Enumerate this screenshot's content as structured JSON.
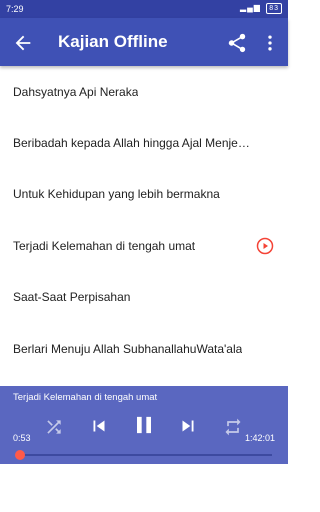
{
  "status_bar": {
    "time": "7:29",
    "battery": "83"
  },
  "app_bar": {
    "title": "Kajian Offline"
  },
  "list": [
    {
      "label": "Dahsyatnya Api Neraka",
      "playing": false
    },
    {
      "label": "Beribadah kepada Allah hingga Ajal Menjemput",
      "playing": false
    },
    {
      "label": "Untuk Kehidupan yang lebih bermakna",
      "playing": false
    },
    {
      "label": "Terjadi Kelemahan di tengah umat",
      "playing": true
    },
    {
      "label": "Saat-Saat Perpisahan",
      "playing": false
    },
    {
      "label": "Berlari Menuju Allah SubhanallahuWata'ala",
      "playing": false
    }
  ],
  "player": {
    "now_playing": "Terjadi Kelemahan di tengah umat",
    "elapsed": "0:53",
    "total": "1:42:01",
    "progress": 0.0087
  },
  "colors": {
    "status_bar": "#3341a3",
    "app_bar": "#3f51b5",
    "player": "#5a67c0",
    "accent": "#ff5a4a",
    "play_indicator": "#f44336"
  },
  "icons": {
    "back": "arrow-left-icon",
    "share": "share-icon",
    "more": "more-vert-icon",
    "shuffle": "shuffle-icon",
    "previous": "skip-previous-icon",
    "pause": "pause-icon",
    "next": "skip-next-icon",
    "repeat": "repeat-icon"
  }
}
